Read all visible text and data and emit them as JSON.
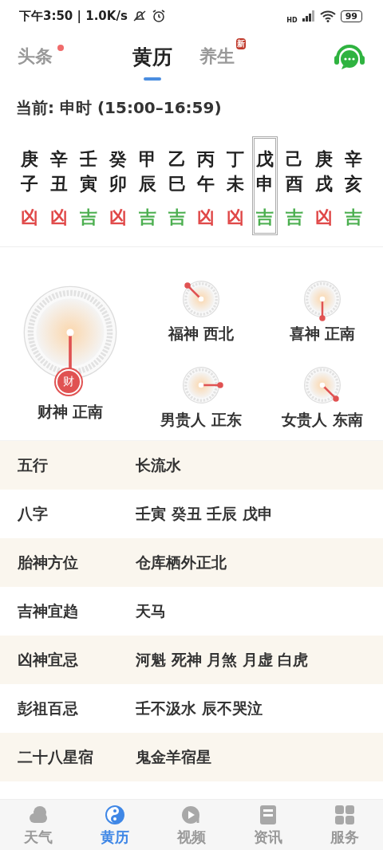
{
  "status_bar": {
    "time": "下午3:50 | 1.0K/s",
    "network_label": "HD",
    "battery": "99"
  },
  "top_tabs": [
    {
      "label": "头条",
      "selected": false,
      "dot": true
    },
    {
      "label": "黄历",
      "selected": true
    },
    {
      "label": "养生",
      "selected": false,
      "badge": "新"
    }
  ],
  "current": "当前: 申时 (15:00–16:59)",
  "hours": [
    {
      "stem": "庚",
      "branch": "子",
      "luck": "凶",
      "kind": "bad",
      "selected": false
    },
    {
      "stem": "辛",
      "branch": "丑",
      "luck": "凶",
      "kind": "bad",
      "selected": false
    },
    {
      "stem": "壬",
      "branch": "寅",
      "luck": "吉",
      "kind": "good",
      "selected": false
    },
    {
      "stem": "癸",
      "branch": "卯",
      "luck": "凶",
      "kind": "bad",
      "selected": false
    },
    {
      "stem": "甲",
      "branch": "辰",
      "luck": "吉",
      "kind": "good",
      "selected": false
    },
    {
      "stem": "乙",
      "branch": "巳",
      "luck": "吉",
      "kind": "good",
      "selected": false
    },
    {
      "stem": "丙",
      "branch": "午",
      "luck": "凶",
      "kind": "bad",
      "selected": false
    },
    {
      "stem": "丁",
      "branch": "未",
      "luck": "凶",
      "kind": "bad",
      "selected": false
    },
    {
      "stem": "戊",
      "branch": "申",
      "luck": "吉",
      "kind": "good",
      "selected": true
    },
    {
      "stem": "己",
      "branch": "酉",
      "luck": "吉",
      "kind": "good",
      "selected": false
    },
    {
      "stem": "庚",
      "branch": "戌",
      "luck": "凶",
      "kind": "bad",
      "selected": false
    },
    {
      "stem": "辛",
      "branch": "亥",
      "luck": "吉",
      "kind": "good",
      "selected": false
    }
  ],
  "wealth_god": {
    "label": "财神 正南",
    "badge": "财",
    "kind": "south"
  },
  "gods": [
    {
      "label": "福神 西北",
      "kind": "northwest"
    },
    {
      "label": "喜神 正南",
      "kind": "south"
    },
    {
      "label": "男贵人 正东",
      "kind": "east"
    },
    {
      "label": "女贵人 东南",
      "kind": "southeast"
    }
  ],
  "details": [
    {
      "label": "五行",
      "value": "长流水"
    },
    {
      "label": "八字",
      "value": "壬寅 癸丑 壬辰 戊申"
    },
    {
      "label": "胎神方位",
      "value": "仓库栖外正北"
    },
    {
      "label": "吉神宜趋",
      "value": "天马"
    },
    {
      "label": "凶神宜忌",
      "value": "河魁 死神 月煞 月虚 白虎"
    },
    {
      "label": "彭祖百忌",
      "value": "壬不汲水 辰不哭泣"
    },
    {
      "label": "二十八星宿",
      "value": "鬼金羊宿星"
    }
  ],
  "bottom_nav": [
    {
      "label": "天气",
      "kind": "cloud",
      "selected": false
    },
    {
      "label": "黄历",
      "kind": "yinyang",
      "selected": true
    },
    {
      "label": "视频",
      "kind": "video",
      "selected": false
    },
    {
      "label": "资讯",
      "kind": "news",
      "selected": false
    },
    {
      "label": "服务",
      "kind": "grid",
      "selected": false
    }
  ]
}
